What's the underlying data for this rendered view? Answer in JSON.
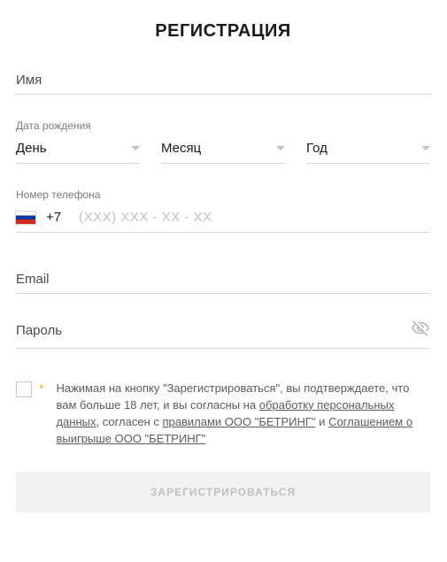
{
  "title": "РЕГИСТРАЦИЯ",
  "name_field": {
    "placeholder": "Имя",
    "value": ""
  },
  "dob": {
    "label": "Дата рождения",
    "day": "День",
    "month": "Месяц",
    "year": "Год"
  },
  "phone": {
    "label": "Номер телефона",
    "country_code": "+7",
    "placeholder": "(XXX) XXX - XX - XX"
  },
  "email": {
    "placeholder": "Email",
    "value": ""
  },
  "password": {
    "placeholder": "Пароль",
    "value": ""
  },
  "agreement": {
    "prefix": "Нажимая на кнопку \"Зарегистрироваться\", вы подтверждаете, что вам больше 18 лет, и вы согласны на ",
    "link1": "обработку персональных данных",
    "mid1": ", согласен с ",
    "link2": "правилами ООО \"БЕТРИНГ\"",
    "mid2": " и ",
    "link3": "Соглашением о выигрыше ООО \"БЕТРИНГ\""
  },
  "submit_label": "ЗАРЕГИСТРИРОВАТЬСЯ",
  "asterisk": "*"
}
